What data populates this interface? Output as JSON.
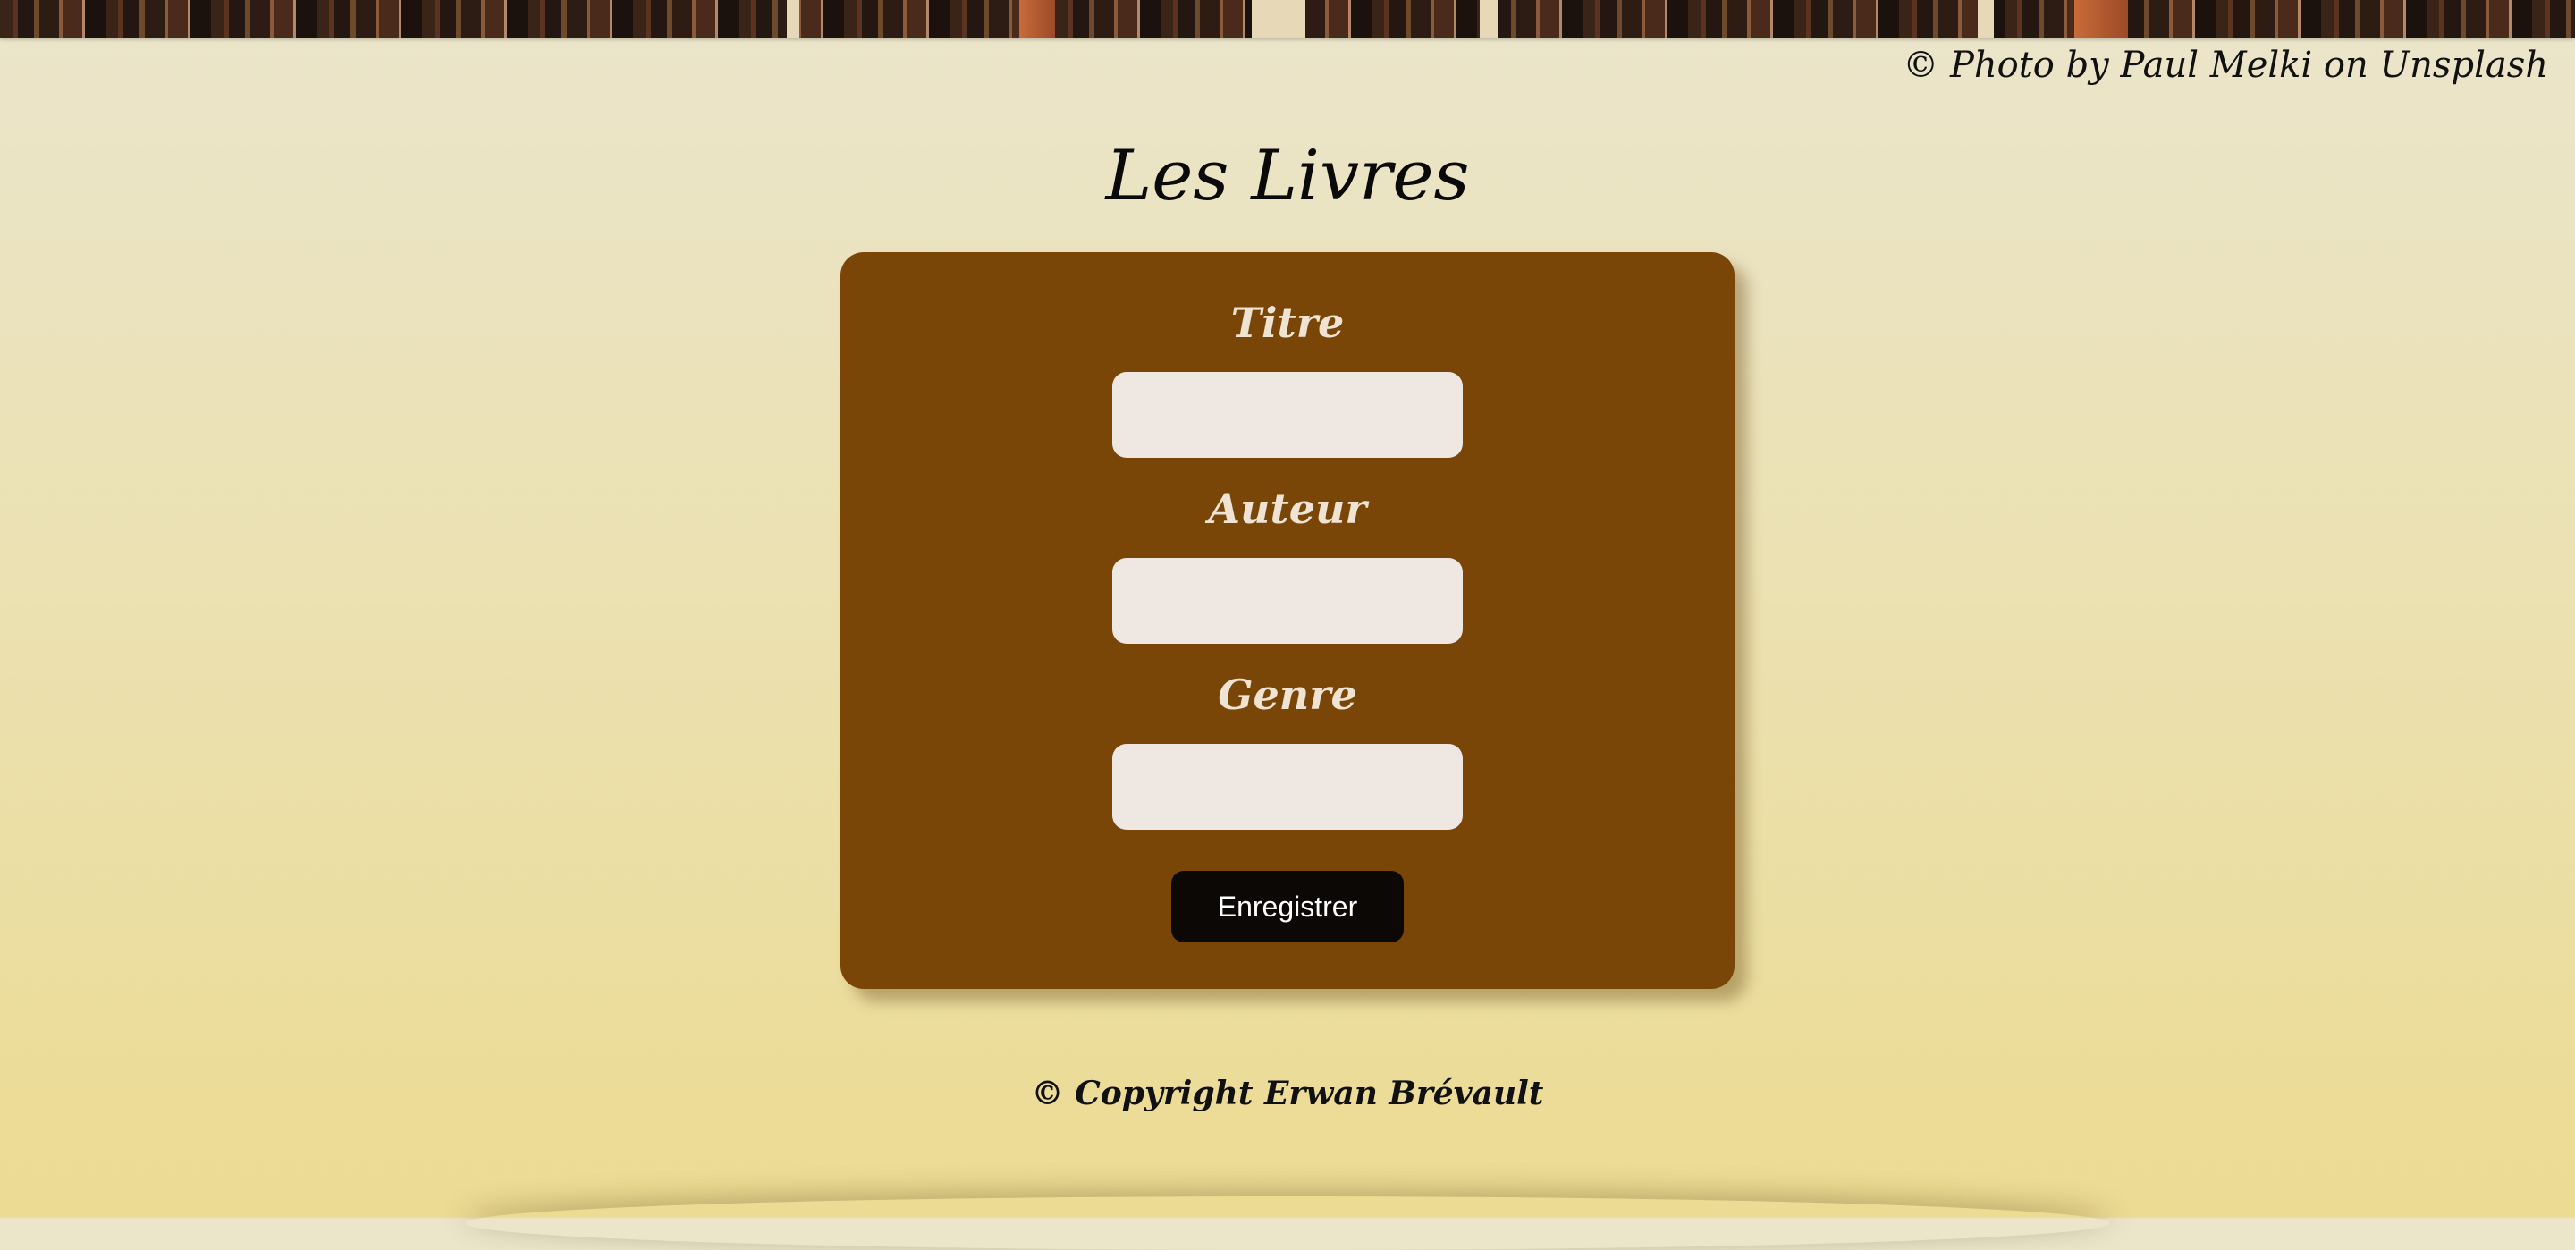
{
  "header": {
    "photo_credit": "© Photo by Paul Melki on Unsplash"
  },
  "page": {
    "title": "Les Livres"
  },
  "form": {
    "fields": [
      {
        "label": "Titre",
        "value": "",
        "placeholder": ""
      },
      {
        "label": "Auteur",
        "value": "",
        "placeholder": ""
      },
      {
        "label": "Genre",
        "value": "",
        "placeholder": ""
      }
    ],
    "submit_label": "Enregistrer"
  },
  "footer": {
    "copyright": "© Copyright Erwan Brévault"
  },
  "colors": {
    "card_background": "#7a4608",
    "button_background": "#0b0806",
    "input_background": "#efe7e2",
    "label_color": "#efe3d3"
  }
}
